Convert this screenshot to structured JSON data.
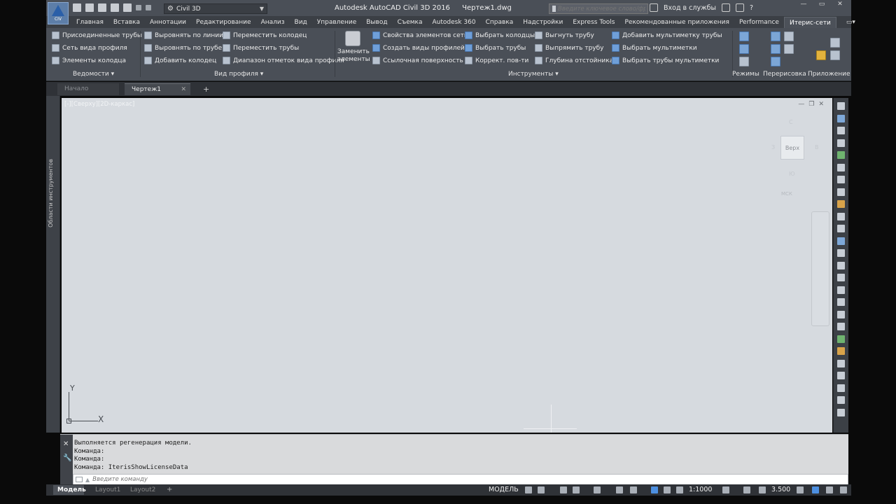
{
  "titlebar": {
    "app_button_label": "CIV",
    "workspace": "Civil 3D",
    "app_name": "Autodesk AutoCAD Civil 3D 2016",
    "file_name": "Чертеж1.dwg",
    "search_placeholder": "Введите ключевое слово/фразу",
    "sign_in": "Вход в службы",
    "help": "?"
  },
  "ribbon_tabs": [
    "Главная",
    "Вставка",
    "Аннотации",
    "Редактирование",
    "Анализ",
    "Вид",
    "Управление",
    "Вывод",
    "Съемка",
    "Autodesk 360",
    "Справка",
    "Надстройки",
    "Express Tools",
    "Рекомендованные приложения",
    "Performance",
    "Итерис-сети"
  ],
  "ribbon": {
    "col1": [
      "Присоединенные трубы",
      "Сеть вида профиля",
      "Элементы колодца"
    ],
    "col2": [
      "Выровнять по линии",
      "Выровнять по трубе",
      "Добавить колодец"
    ],
    "col3": [
      "Переместить колодец",
      "Переместить трубы",
      "Диапазон отметок вида профиля"
    ],
    "big_button": [
      "Заменить",
      "элементы"
    ],
    "col4": [
      "Свойства элементов сети",
      "Создать виды профилей",
      "Ссылочная поверхность"
    ],
    "col5": [
      "Выбрать колодцы",
      "Выбрать трубы",
      "Коррект. пов-ти"
    ],
    "col6": [
      "Выгнуть трубу",
      "Выпрямить трубу",
      "Глубина отстойника"
    ],
    "col7": [
      "Добавить мультиметку трубы",
      "Выбрать мультиметки",
      "Выбрать трубы мультиметки"
    ],
    "panels": {
      "vedomosti": "Ведомости",
      "vid_profilya": "Вид профиля",
      "instrumenty": "Инструменты",
      "rezhimy": "Режимы",
      "pererisovka": "Перерисовка",
      "prilozhenie": "Приложение"
    }
  },
  "file_tabs": {
    "start": "Начало",
    "drawing": "Чертеж1",
    "add": "+"
  },
  "left_palette_label": "Области инструментов",
  "canvas": {
    "viewport_label": "[-][Сверху][2D-каркас]",
    "viewcube_face": "Верх",
    "viewcube_n": "С",
    "viewcube_s": "Ю",
    "viewcube_w": "З",
    "viewcube_e": "В",
    "wcs": "МСК",
    "ucs_x": "X",
    "ucs_y": "Y"
  },
  "command": {
    "history": [
      "Выполняется регенерация модели.",
      "Команда:",
      "Команда:",
      "Команда: IterisShowLicenseData"
    ],
    "placeholder": "Введите команду"
  },
  "statusbar": {
    "model_tab": "Модель",
    "layout1": "Layout1",
    "layout2": "Layout2",
    "add": "+",
    "model_space": "МОДЕЛЬ",
    "scale": "1:1000",
    "annotation_value": "3.500"
  },
  "colors": {
    "canvas": "#d6dadf",
    "chrome": "#4a4f57",
    "active_blue": "#4d8fe0"
  }
}
